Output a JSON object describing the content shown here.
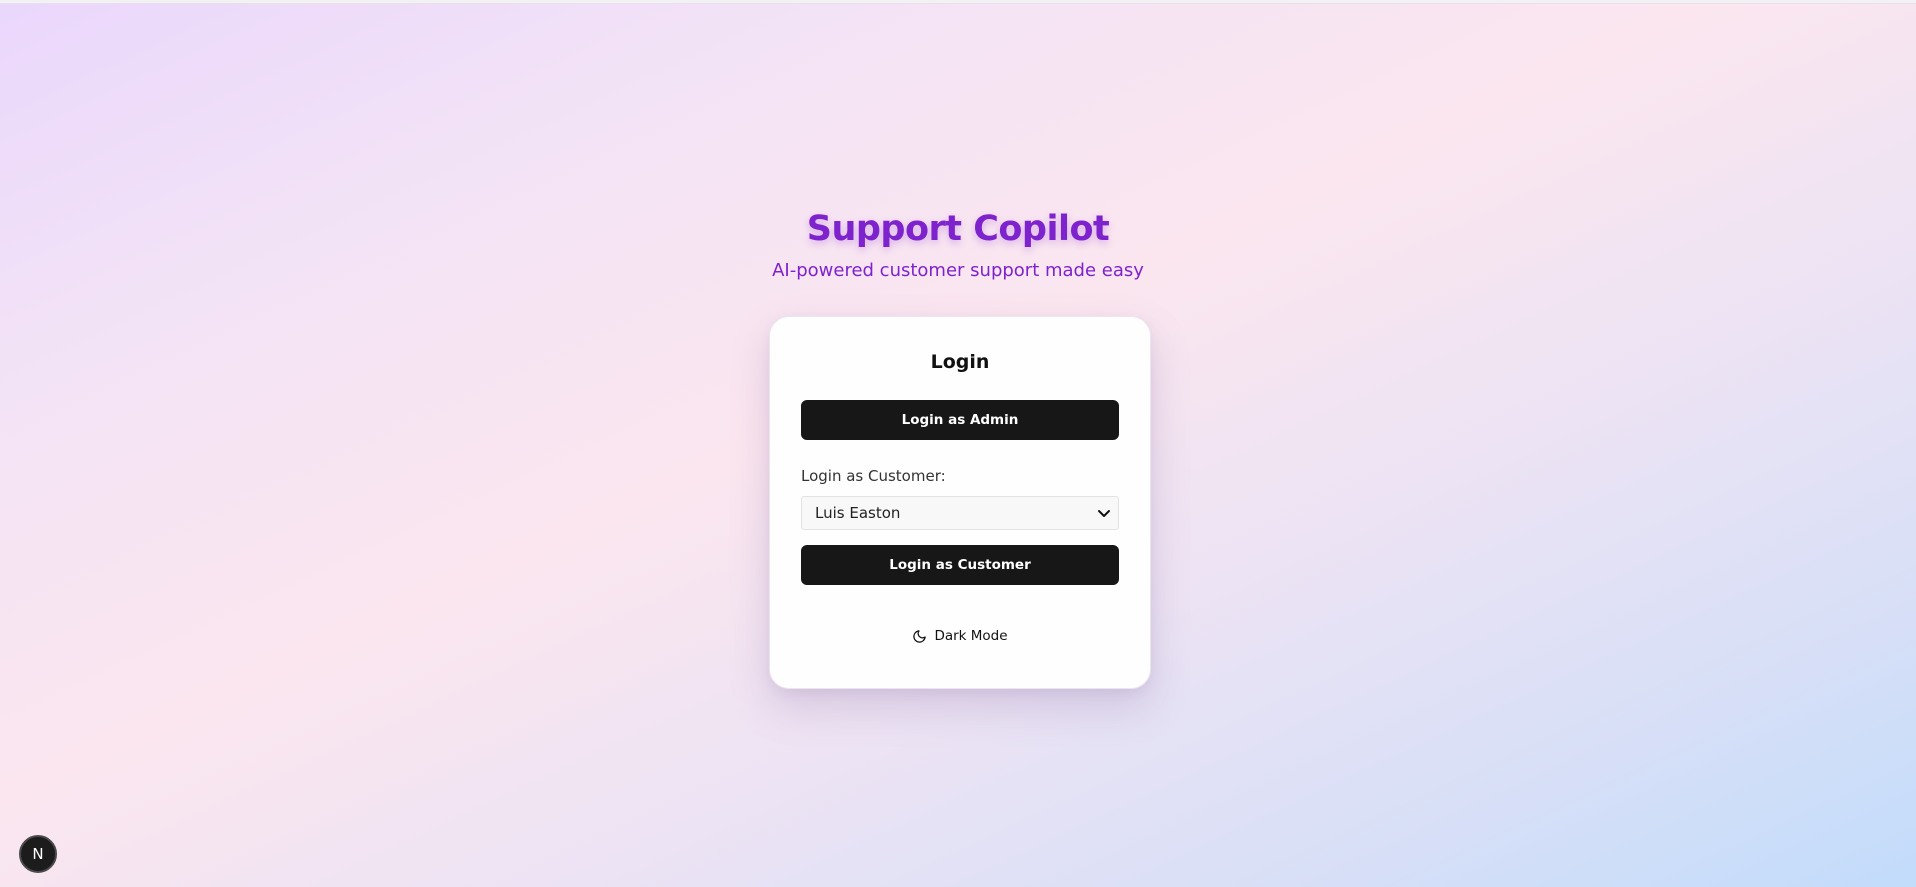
{
  "header": {
    "title": "Support Copilot",
    "subtitle": "AI-powered customer support made easy"
  },
  "login_card": {
    "title": "Login",
    "admin_button_label": "Login as Admin",
    "customer_label": "Login as Customer:",
    "customer_select": {
      "selected_value": "Luis Easton",
      "icon": "chevron-down-icon"
    },
    "customer_button_label": "Login as Customer",
    "dark_mode": {
      "label": "Dark Mode",
      "icon": "moon-icon"
    }
  },
  "dev_badge": {
    "letter": "N",
    "icon": "nextjs-icon"
  },
  "colors": {
    "brand": "#7e22ce",
    "button_bg": "#171717",
    "button_text": "#ffffff"
  }
}
